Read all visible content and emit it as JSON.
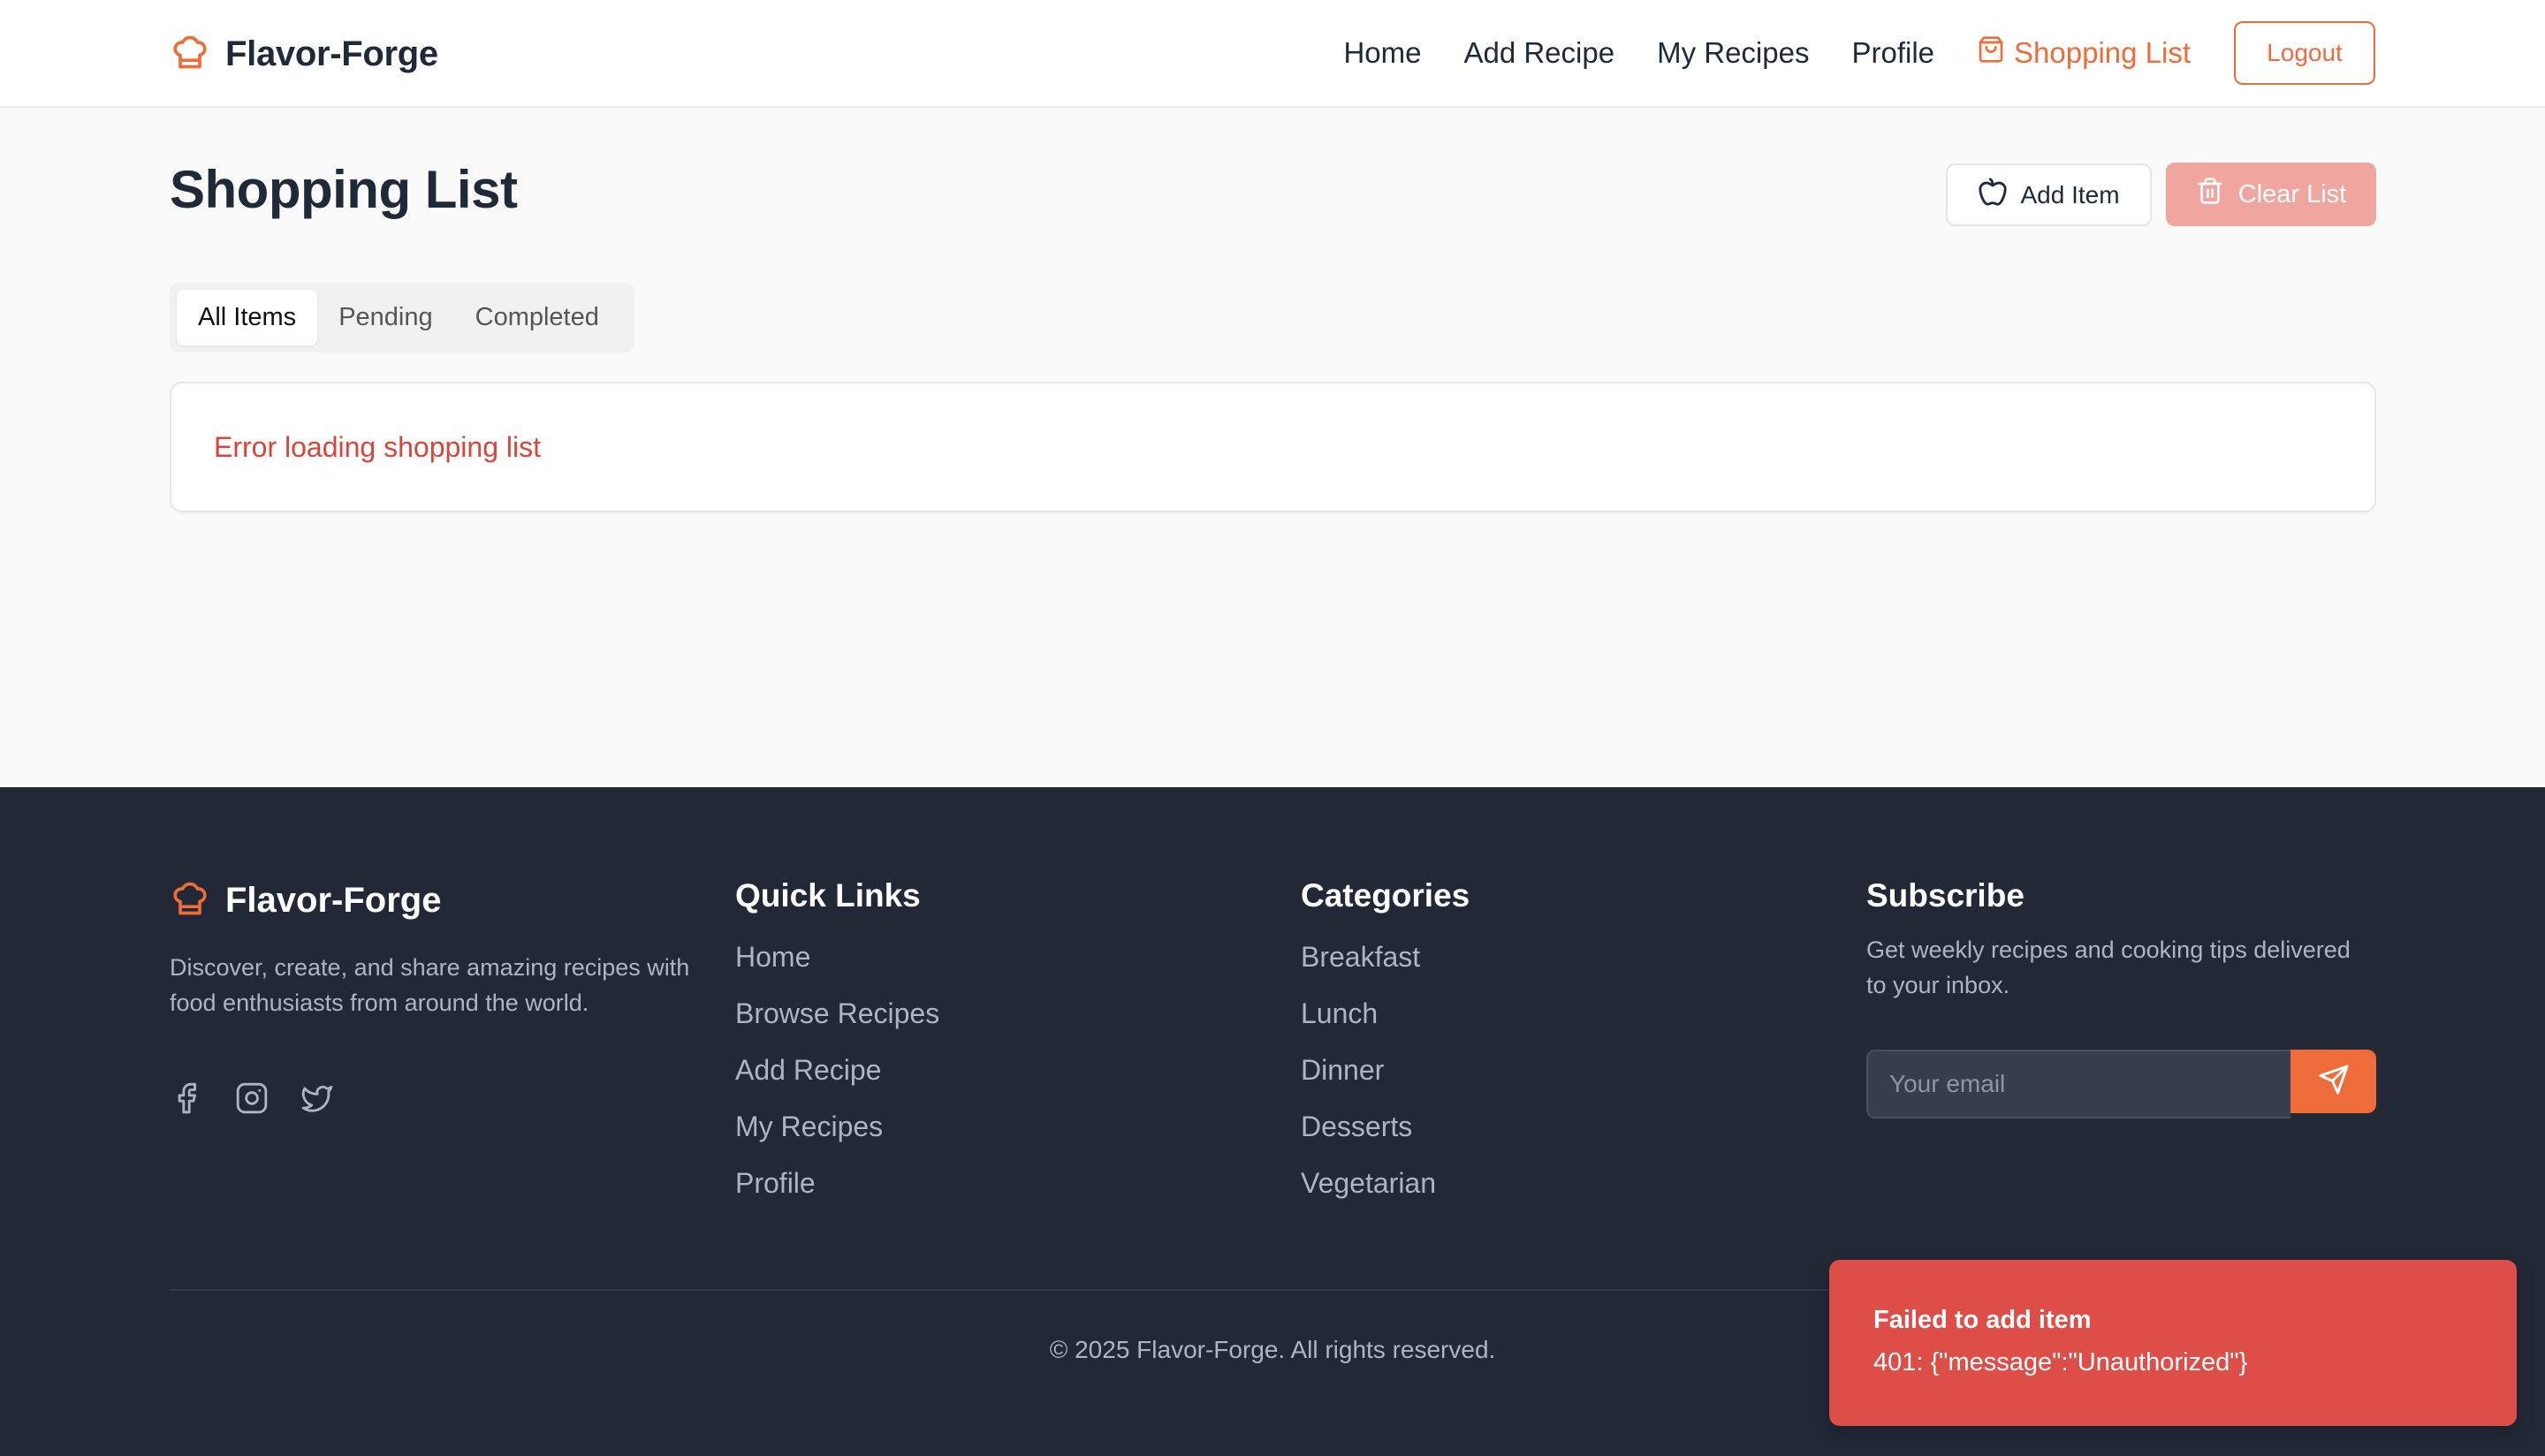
{
  "brand": {
    "name": "Flavor-Forge",
    "icon": "chef-hat-icon",
    "accent": "#ee6c3a"
  },
  "nav": {
    "items": [
      {
        "label": "Home"
      },
      {
        "label": "Add Recipe"
      },
      {
        "label": "My Recipes"
      },
      {
        "label": "Profile"
      },
      {
        "label": "Shopping List",
        "icon": "shopping-bag-icon",
        "active": true
      }
    ],
    "logout_label": "Logout"
  },
  "page": {
    "title": "Shopping List",
    "add_item_label": "Add Item",
    "add_item_icon": "apple-icon",
    "clear_list_label": "Clear List",
    "clear_list_icon": "trash-icon",
    "clear_list_disabled": true
  },
  "tabs": [
    {
      "label": "All Items",
      "active": true
    },
    {
      "label": "Pending"
    },
    {
      "label": "Completed"
    }
  ],
  "error": {
    "message": "Error loading shopping list",
    "color": "#d9453a"
  },
  "footer": {
    "brand_name": "Flavor-Forge",
    "description": "Discover, create, and share amazing recipes with food enthusiasts from around the world.",
    "socials": [
      "facebook-icon",
      "instagram-icon",
      "twitter-icon"
    ],
    "quick_links": {
      "title": "Quick Links",
      "items": [
        "Home",
        "Browse Recipes",
        "Add Recipe",
        "My Recipes",
        "Profile"
      ]
    },
    "categories": {
      "title": "Categories",
      "items": [
        "Breakfast",
        "Lunch",
        "Dinner",
        "Desserts",
        "Vegetarian"
      ]
    },
    "subscribe": {
      "title": "Subscribe",
      "description": "Get weekly recipes and cooking tips delivered to your inbox.",
      "placeholder": "Your email",
      "button_icon": "send-icon"
    },
    "copyright": "© 2025 Flavor-Forge. All rights reserved.",
    "background": "#232836"
  },
  "toast": {
    "title": "Failed to add item",
    "message": "401: {\"message\":\"Unauthorized\"}",
    "color": "#de4e48"
  }
}
